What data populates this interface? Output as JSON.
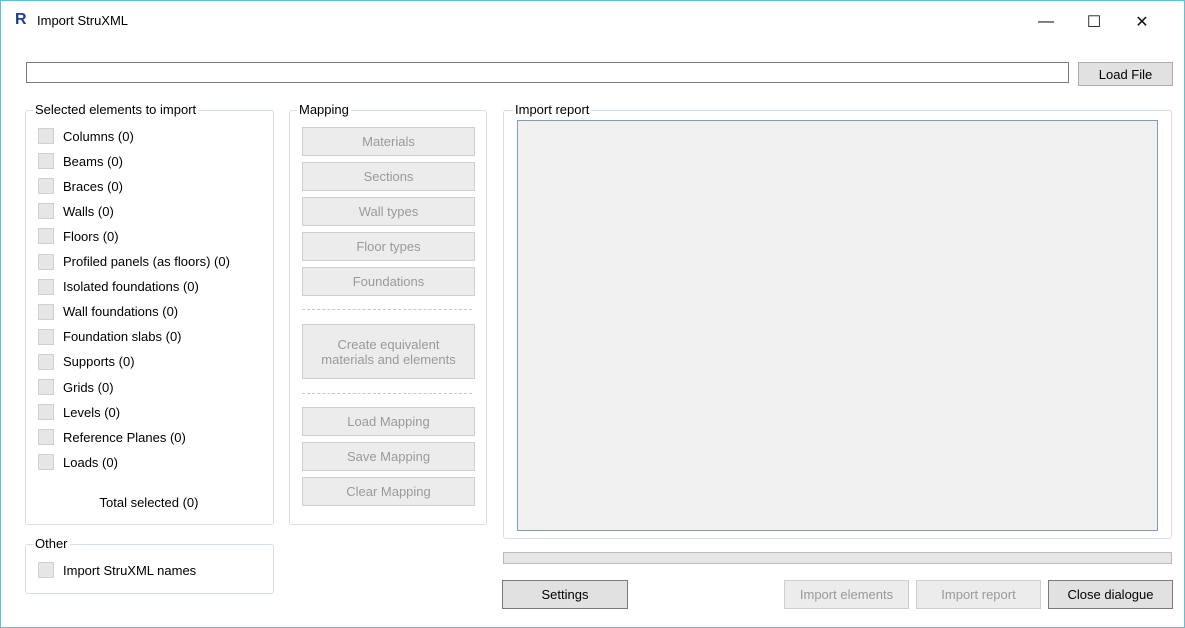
{
  "window": {
    "title": "Import StruXML",
    "app_icon_letter": "R",
    "controls": {
      "minimize": "—",
      "maximize": "☐",
      "close": "✕"
    }
  },
  "file": {
    "path_value": "",
    "load_label": "Load File"
  },
  "selected": {
    "legend": "Selected elements to import",
    "items": [
      {
        "label": "Columns (0)",
        "checked": false
      },
      {
        "label": "Beams (0)",
        "checked": false
      },
      {
        "label": "Braces (0)",
        "checked": false
      },
      {
        "label": "Walls (0)",
        "checked": false
      },
      {
        "label": "Floors (0)",
        "checked": false
      },
      {
        "label": "Profiled panels (as floors) (0)",
        "checked": false
      },
      {
        "label": "Isolated foundations (0)",
        "checked": false
      },
      {
        "label": "Wall foundations (0)",
        "checked": false
      },
      {
        "label": "Foundation slabs (0)",
        "checked": false
      },
      {
        "label": "Supports (0)",
        "checked": false
      },
      {
        "label": "Grids (0)",
        "checked": false
      },
      {
        "label": "Levels (0)",
        "checked": false
      },
      {
        "label": "Reference Planes (0)",
        "checked": false
      },
      {
        "label": "Loads (0)",
        "checked": false
      }
    ],
    "total": "Total selected (0)"
  },
  "other": {
    "legend": "Other",
    "import_names_label": "Import StruXML names"
  },
  "mapping": {
    "legend": "Mapping",
    "materials": "Materials",
    "sections": "Sections",
    "wall_types": "Wall types",
    "floor_types": "Floor types",
    "foundations": "Foundations",
    "create_line1": "Create equivalent",
    "create_line2": "materials and elements",
    "load": "Load Mapping",
    "save": "Save Mapping",
    "clear": "Clear Mapping"
  },
  "report": {
    "legend": "Import report",
    "content": "",
    "progress": 0
  },
  "footer": {
    "settings": "Settings",
    "import_elements": "Import elements",
    "import_report": "Import report",
    "close_dialogue": "Close dialogue"
  }
}
